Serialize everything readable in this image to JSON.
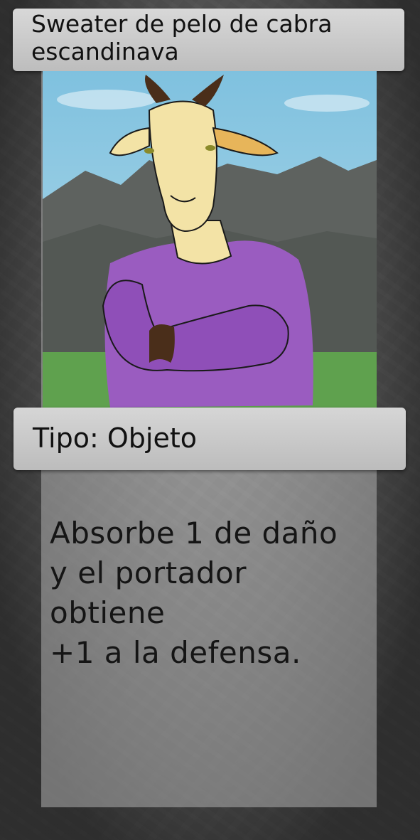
{
  "card": {
    "title": "Sweater de pelo de cabra escandinava",
    "type_line": "Tipo: Objeto",
    "description_lines": [
      "Absorbe 1 de daño",
      "y el portador",
      "obtiene",
      "+1 a la defensa."
    ]
  },
  "art": {
    "subject": "goat-in-purple-sweater",
    "colors": {
      "sky": "#8ec9e0",
      "mountains": "#5e625f",
      "grass": "#5fa14e",
      "sweater": "#9a5cc0",
      "fur": "#f3e3a6",
      "horns": "#4a2e1a"
    }
  }
}
